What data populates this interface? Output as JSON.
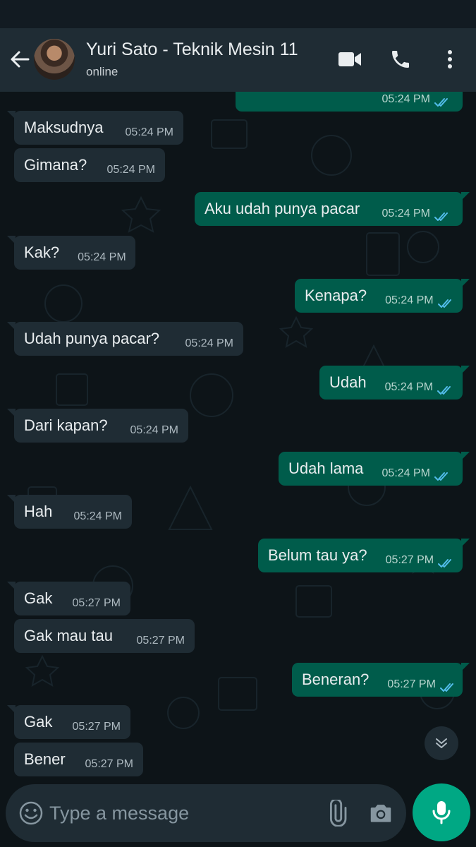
{
  "header": {
    "contact_name": "Yuri Sato - Teknik Mesin 11",
    "status": "online",
    "back_icon": "arrow-left-icon",
    "video_icon": "video-camera-icon",
    "call_icon": "phone-icon",
    "menu_icon": "more-vertical-icon"
  },
  "messages": [
    {
      "dir": "out",
      "text": "",
      "time": "05:24 PM",
      "ticks": "double-check-icon"
    },
    {
      "dir": "in",
      "text": "Maksudnya",
      "time": "05:24 PM"
    },
    {
      "dir": "in",
      "text": "Gimana?",
      "time": "05:24 PM"
    },
    {
      "dir": "out",
      "text": "Aku udah punya pacar",
      "time": "05:24 PM",
      "ticks": "double-check-icon"
    },
    {
      "dir": "in",
      "text": "Kak?",
      "time": "05:24 PM"
    },
    {
      "dir": "out",
      "text": "Kenapa?",
      "time": "05:24 PM",
      "ticks": "double-check-icon"
    },
    {
      "dir": "in",
      "text": "Udah punya pacar?",
      "time": "05:24 PM"
    },
    {
      "dir": "out",
      "text": "Udah",
      "time": "05:24 PM",
      "ticks": "double-check-icon"
    },
    {
      "dir": "in",
      "text": "Dari kapan?",
      "time": "05:24 PM"
    },
    {
      "dir": "out",
      "text": "Udah lama",
      "time": "05:24 PM",
      "ticks": "double-check-icon"
    },
    {
      "dir": "in",
      "text": "Hah",
      "time": "05:24 PM"
    },
    {
      "dir": "out",
      "text": "Belum tau ya?",
      "time": "05:27 PM",
      "ticks": "double-check-icon"
    },
    {
      "dir": "in",
      "text": "Gak",
      "time": "05:27 PM"
    },
    {
      "dir": "in",
      "text": "Gak mau tau",
      "time": "05:27 PM"
    },
    {
      "dir": "out",
      "text": "Beneran?",
      "time": "05:27 PM",
      "ticks": "double-check-icon"
    },
    {
      "dir": "in",
      "text": "Gak",
      "time": "05:27 PM"
    },
    {
      "dir": "in",
      "text": "Bener",
      "time": "05:27 PM"
    }
  ],
  "composer": {
    "placeholder": "Type a message",
    "emoji_icon": "emoji-icon",
    "attach_icon": "paperclip-icon",
    "camera_icon": "camera-icon",
    "mic_icon": "microphone-icon",
    "scroll_icon": "chevron-double-down-icon"
  },
  "colors": {
    "header_bg": "#1f2c34",
    "chat_bg": "#0d1418",
    "incoming_bubble": "#1f2c34",
    "outgoing_bubble": "#005c4b",
    "read_ticks": "#53bdeb",
    "accent": "#00a884"
  }
}
